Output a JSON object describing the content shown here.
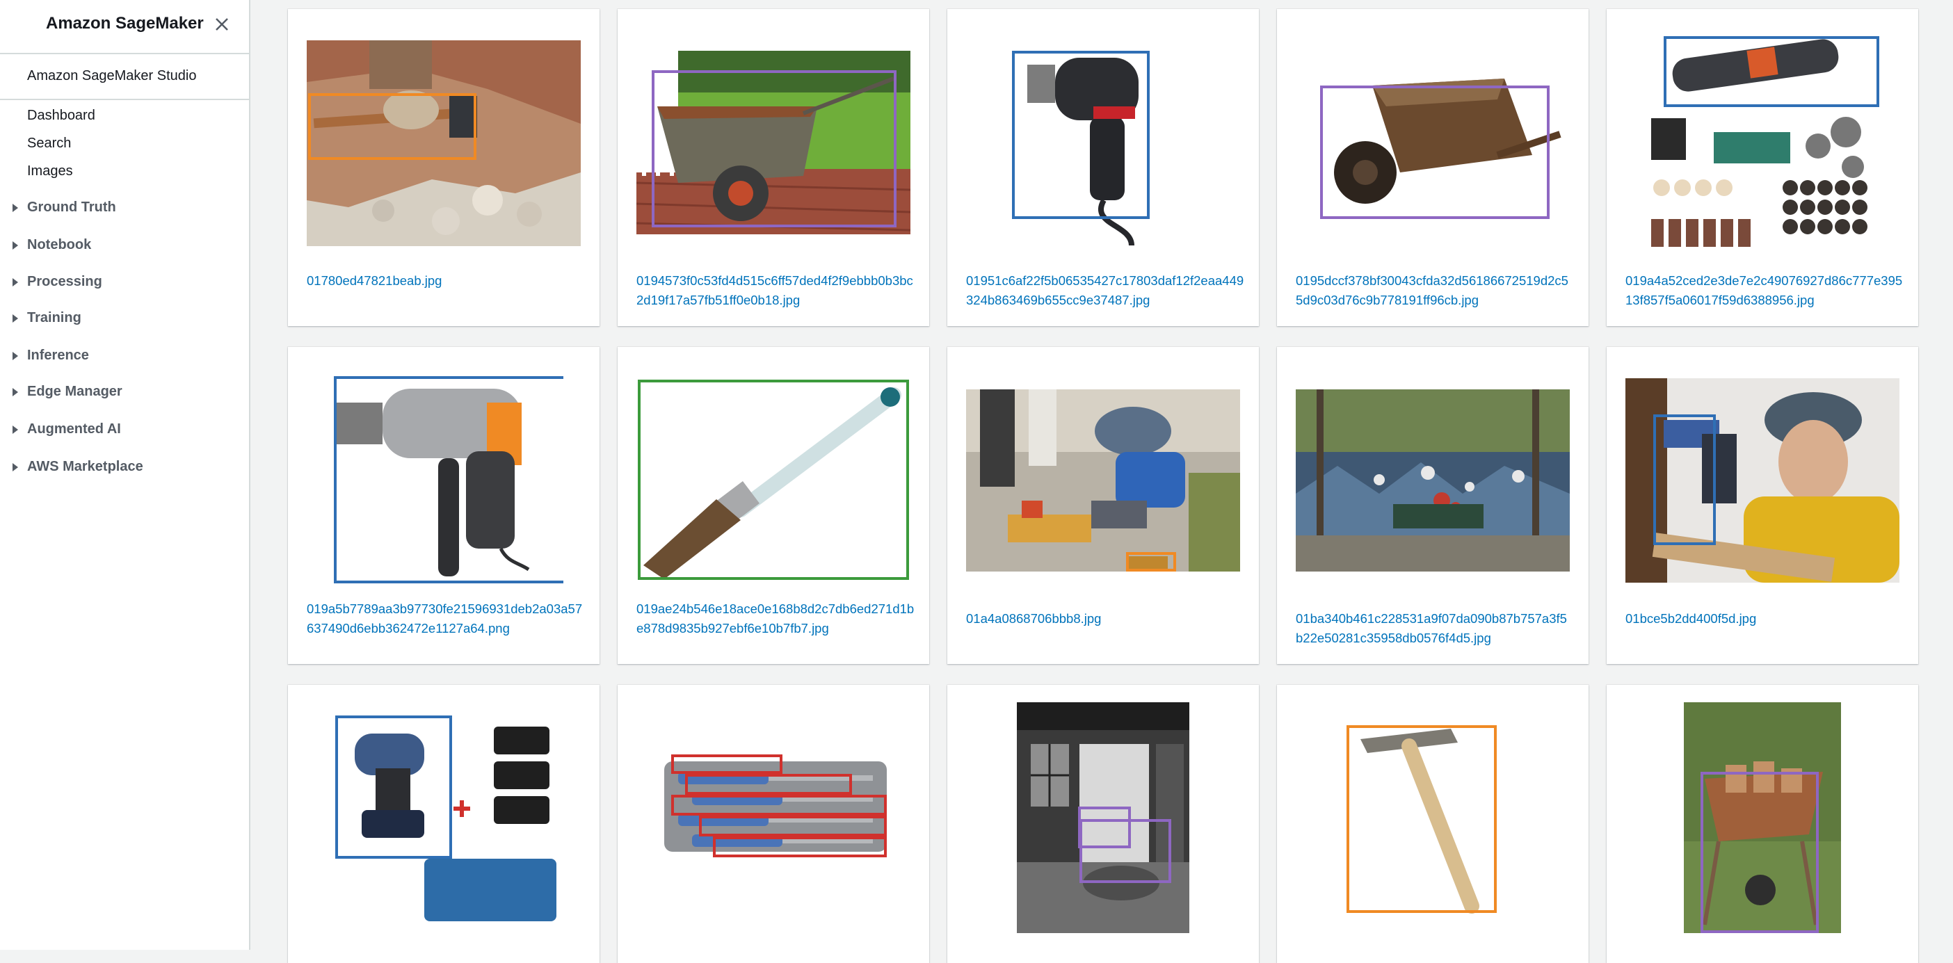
{
  "sidebar": {
    "title": "Amazon SageMaker",
    "studio": "Amazon SageMaker Studio",
    "links": [
      "Dashboard",
      "Search",
      "Images"
    ],
    "sections": [
      "Ground Truth",
      "Notebook",
      "Processing",
      "Training",
      "Inference",
      "Edge Manager",
      "Augmented AI",
      "AWS Marketplace"
    ]
  },
  "images": [
    {
      "file": "01780ed47821beab.jpg",
      "subject": "hammer-on-rocks",
      "box_colors": [
        "#f08a24"
      ]
    },
    {
      "file": "0194573f0c53fd4d515c6ff57ded4f2f9ebbb0b3bc2d19f17a57fb51ff0e0b18.jpg",
      "subject": "wheelbarrow-on-deck",
      "box_colors": [
        "#8e67c2"
      ]
    },
    {
      "file": "01951c6af22f5b06535427c17803daf12f2eaa449324b863469b655cc9e37487.jpg",
      "subject": "power-drill",
      "box_colors": [
        "#2f6fb5"
      ]
    },
    {
      "file": "0195dccf378bf30043cfda32d56186672519d2c55d9c03d76c9b778191ff96cb.jpg",
      "subject": "wooden-wheelbarrow",
      "box_colors": [
        "#8e67c2"
      ]
    },
    {
      "file": "019a4a52ced2e3de7e2c49076927d86c777e39513f857f5a06017f59d6388956.jpg",
      "subject": "rotary-tool-kit",
      "box_colors": [
        "#2f6fb5"
      ]
    },
    {
      "file": "019a5b7789aa3b97730fe21596931deb2a03a57637490d6ebb362472e1127a64.png",
      "subject": "hammer-drill",
      "box_colors": [
        "#2f6fb5"
      ]
    },
    {
      "file": "019ae24b546e18ace0e168b8d2c7db6ed271d1be878d9835b927ebf6e10b7fb7.jpg",
      "subject": "paint-brush",
      "box_colors": [
        "#3c9b3c"
      ]
    },
    {
      "file": "01a4a0868706bbb8.jpg",
      "subject": "child-with-toy-tools",
      "box_colors": [
        "#f08a24"
      ]
    },
    {
      "file": "01ba340b461c228531a9f07da090b87b757a3f5b22e50281c35958db0576f4d5.jpg",
      "subject": "park-bench-mural",
      "box_colors": []
    },
    {
      "file": "01bce5b2dd400f5d.jpg",
      "subject": "man-with-drill",
      "box_colors": [
        "#2f6fb5"
      ]
    },
    {
      "file": "",
      "subject": "cordless-drill-set",
      "box_colors": [
        "#2f6fb5"
      ]
    },
    {
      "file": "",
      "subject": "screwdriver-set",
      "box_colors": [
        "#d0312d"
      ]
    },
    {
      "file": "",
      "subject": "barn-interior",
      "box_colors": [
        "#8e67c2"
      ]
    },
    {
      "file": "",
      "subject": "claw-hammer",
      "box_colors": [
        "#f08a24"
      ]
    },
    {
      "file": "",
      "subject": "wheelbarrow-with-wood",
      "box_colors": [
        "#8e67c2"
      ]
    }
  ]
}
